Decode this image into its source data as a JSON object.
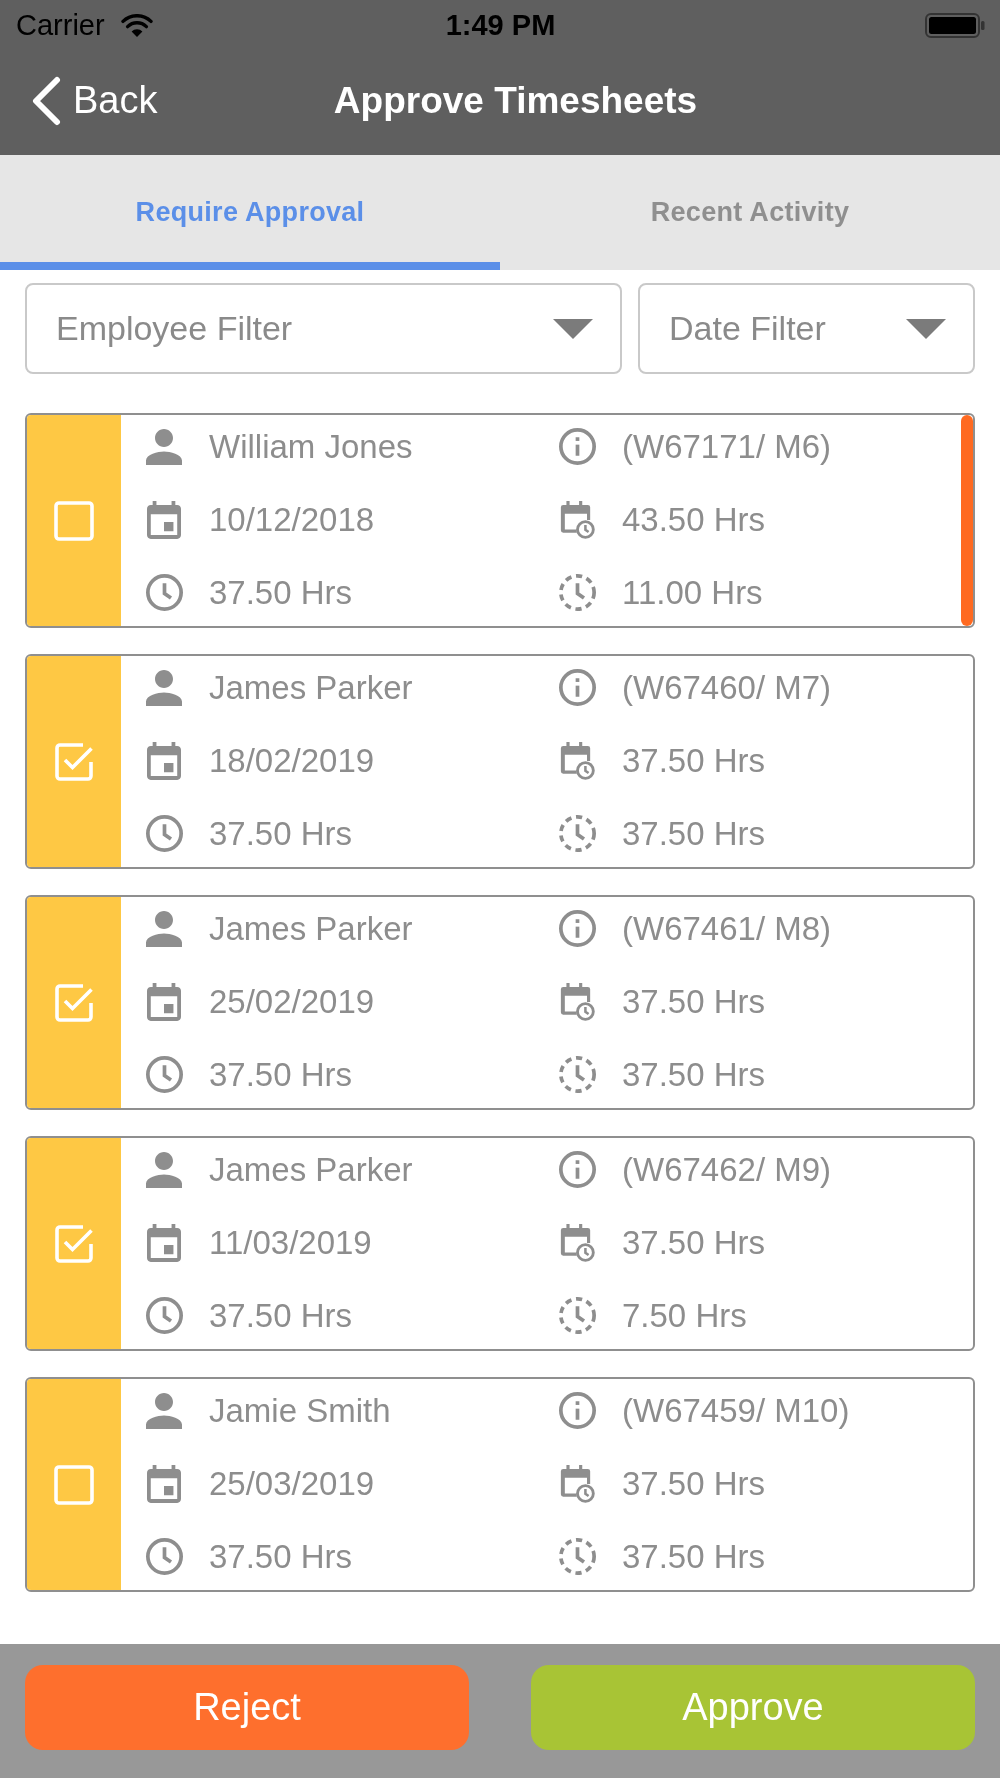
{
  "status_bar": {
    "carrier": "Carrier",
    "time": "1:49 PM"
  },
  "nav_bar": {
    "back_label": "Back",
    "title": "Approve Timesheets"
  },
  "tabs": [
    {
      "label": "Require Approval",
      "selected": true
    },
    {
      "label": "Recent Activity",
      "selected": false
    }
  ],
  "filters": [
    {
      "placeholder": "Employee Filter"
    },
    {
      "placeholder": "Date Filter"
    }
  ],
  "timesheets": [
    {
      "checked": false,
      "flagged": true,
      "employee": "William Jones",
      "reference": "(W67171/ M6)",
      "date": "10/12/2018",
      "period_hours": "43.50 Hrs",
      "hours": "37.50 Hrs",
      "extra_hours": "11.00 Hrs"
    },
    {
      "checked": true,
      "flagged": false,
      "employee": "James Parker",
      "reference": "(W67460/ M7)",
      "date": "18/02/2019",
      "period_hours": "37.50 Hrs",
      "hours": "37.50 Hrs",
      "extra_hours": "37.50 Hrs"
    },
    {
      "checked": true,
      "flagged": false,
      "employee": "James Parker",
      "reference": "(W67461/ M8)",
      "date": "25/02/2019",
      "period_hours": "37.50 Hrs",
      "hours": "37.50 Hrs",
      "extra_hours": "37.50 Hrs"
    },
    {
      "checked": true,
      "flagged": false,
      "employee": "James Parker",
      "reference": "(W67462/ M9)",
      "date": "11/03/2019",
      "period_hours": "37.50 Hrs",
      "hours": "37.50 Hrs",
      "extra_hours": "7.50 Hrs"
    },
    {
      "checked": false,
      "flagged": false,
      "employee": "Jamie Smith",
      "reference": "(W67459/ M10)",
      "date": "25/03/2019",
      "period_hours": "37.50 Hrs",
      "hours": "37.50 Hrs",
      "extra_hours": "37.50 Hrs"
    }
  ],
  "actions": [
    {
      "label": "Reject",
      "kind": "reject"
    },
    {
      "label": "Approve",
      "kind": "approve"
    }
  ]
}
